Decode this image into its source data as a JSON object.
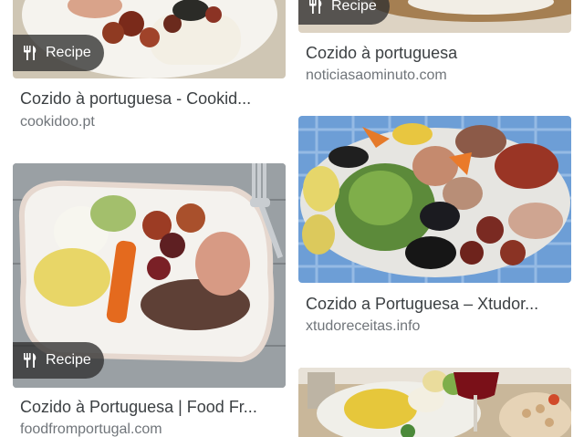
{
  "results": [
    {
      "badge": "Recipe",
      "title": "Cozido à portuguesa - Cookid...",
      "source": "cookidoo.pt"
    },
    {
      "badge": "Recipe",
      "title": "Cozido à portuguesa",
      "source": "noticiasaominuto.com"
    },
    {
      "badge": "Recipe",
      "title": "Cozido à Portuguesa | Food Fr...",
      "source": "foodfromportugal.com"
    },
    {
      "title": "Cozido a Portuguesa – Xtudor...",
      "source": "xtudoreceitas.info"
    }
  ]
}
